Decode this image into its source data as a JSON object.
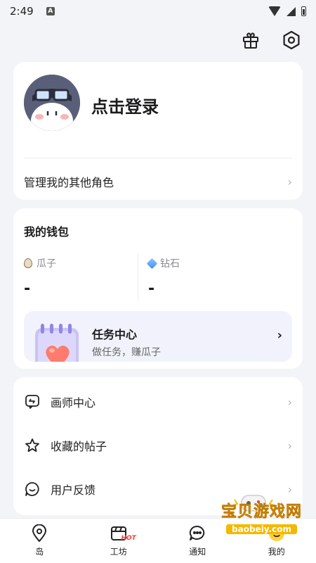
{
  "status": {
    "time": "2:49",
    "app_badge": "A"
  },
  "profile": {
    "login_label": "点击登录",
    "manage_roles_label": "管理我的其他角色"
  },
  "wallet": {
    "title": "我的钱包",
    "seeds": {
      "label": "瓜子",
      "value": "-"
    },
    "diamonds": {
      "label": "钻石",
      "value": "-"
    }
  },
  "task": {
    "title": "任务中心",
    "subtitle": "做任务，赚瓜子",
    "arrow": "›"
  },
  "menu": {
    "items": [
      {
        "label": "画师中心",
        "icon": "artist-icon"
      },
      {
        "label": "收藏的帖子",
        "icon": "star-icon"
      },
      {
        "label": "用户反馈",
        "icon": "feedback-icon"
      }
    ]
  },
  "tabbar": {
    "tabs": [
      {
        "label": "岛",
        "icon": "island-icon"
      },
      {
        "label": "工坊",
        "icon": "workshop-icon",
        "badge": "HOT"
      },
      {
        "label": "通知",
        "icon": "notification-icon"
      },
      {
        "label": "我的",
        "icon": "profile-icon"
      }
    ]
  },
  "watermark": {
    "title": "宝贝游戏网",
    "url": "baobeiy.com"
  },
  "chevron": "›",
  "colors": {
    "background": "#f3f4f8",
    "card": "#ffffff",
    "hot": "#ff3b3b",
    "task_banner": "#f1f2fb"
  }
}
